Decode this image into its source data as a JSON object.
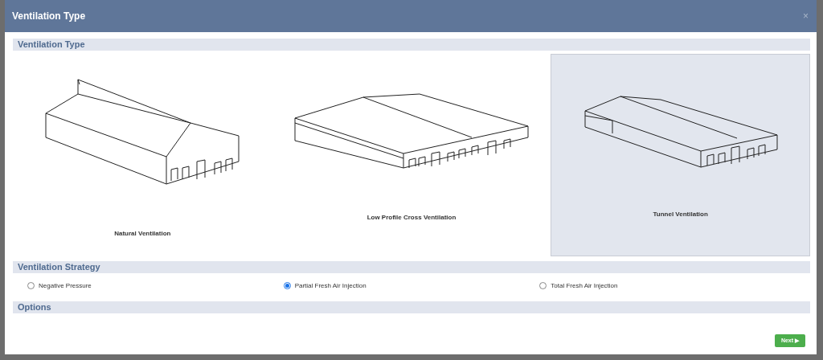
{
  "dialog": {
    "title": "Ventilation Type",
    "close": "×"
  },
  "sections": [
    {
      "kind": "types",
      "title": "Ventilation Type",
      "options": [
        {
          "label": "Natural Ventilation",
          "kind": "natural",
          "selected": false
        },
        {
          "label": "Low Profile Cross Ventilation",
          "kind": "cross",
          "selected": false
        },
        {
          "label": "Tunnel Ventilation",
          "kind": "tunnel",
          "selected": true
        }
      ]
    },
    {
      "kind": "radios",
      "title": "Ventilation Strategy",
      "options": [
        {
          "label": "Negative Pressure",
          "selected": false
        },
        {
          "label": "Partial Fresh Air Injection",
          "selected": true
        },
        {
          "label": "Total Fresh Air Injection",
          "selected": false
        }
      ]
    },
    {
      "kind": "empty",
      "title": "Options"
    }
  ],
  "next_button": {
    "label": "Next",
    "icon": "▶"
  }
}
